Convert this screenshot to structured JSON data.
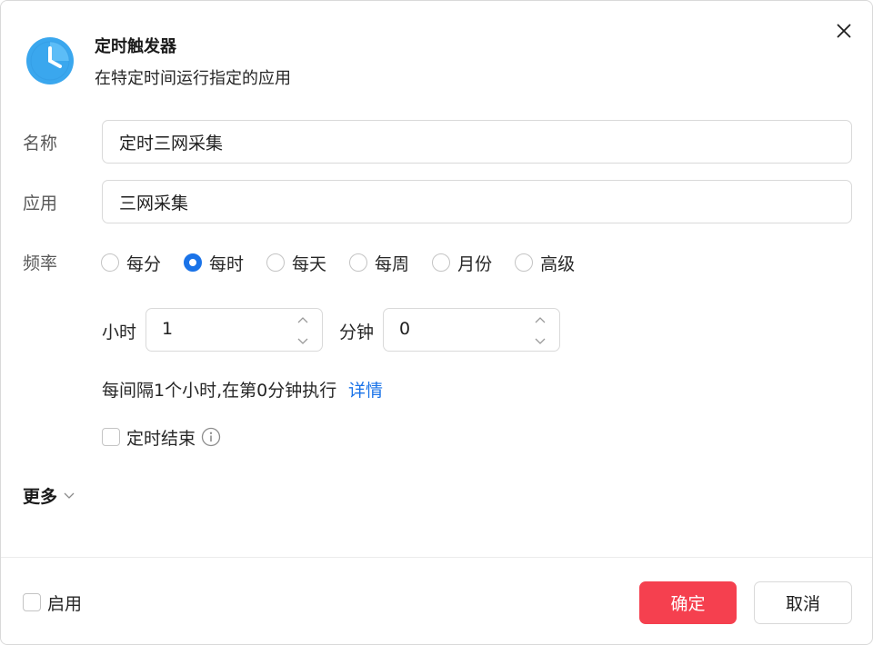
{
  "header": {
    "title": "定时触发器",
    "subtitle": "在特定时间运行指定的应用",
    "icon": "clock-icon",
    "icon_color": "#3aa7ee"
  },
  "form": {
    "name": {
      "label": "名称",
      "value": "定时三网采集"
    },
    "app": {
      "label": "应用",
      "value": "三网采集"
    },
    "frequency": {
      "label": "频率",
      "options": [
        "每分",
        "每时",
        "每天",
        "每周",
        "月份",
        "高级"
      ],
      "selected": "每时"
    },
    "hour": {
      "label": "小时",
      "value": "1"
    },
    "minute": {
      "label": "分钟",
      "value": "0"
    },
    "description": "每间隔1个小时,在第0分钟执行",
    "detail_link": "详情",
    "end_timer": {
      "label": "定时结束",
      "checked": false
    }
  },
  "more": {
    "label": "更多"
  },
  "footer": {
    "enable": {
      "label": "启用",
      "checked": false
    },
    "confirm_label": "确定",
    "cancel_label": "取消",
    "accent": "#f5404f"
  },
  "colors": {
    "primary_blue": "#1a73e8",
    "confirm_red": "#f5404f"
  }
}
